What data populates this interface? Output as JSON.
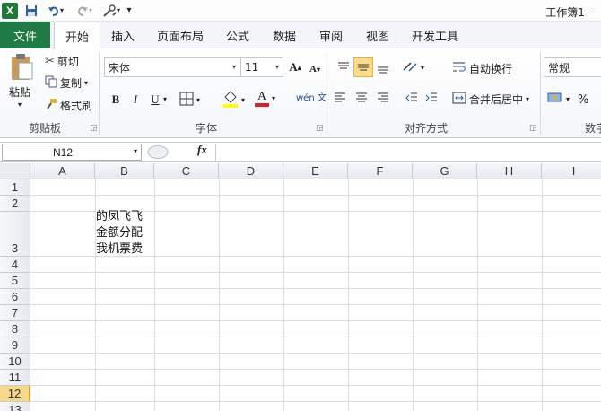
{
  "title_bar": {
    "app_icon": "X",
    "document_title": "工作簿1 -",
    "qa_icons": [
      "excel-icon",
      "save-icon",
      "undo-icon",
      "redo-icon",
      "tools-icon",
      "customize-icon"
    ]
  },
  "tabs": {
    "file": "文件",
    "items": [
      "开始",
      "插入",
      "页面布局",
      "公式",
      "数据",
      "审阅",
      "视图",
      "开发工具"
    ],
    "active": "开始"
  },
  "ribbon": {
    "clipboard": {
      "paste": "粘贴",
      "cut": "剪切",
      "copy": "复制",
      "format_painter": "格式刷",
      "label": "剪贴板"
    },
    "font": {
      "font_name": "宋体",
      "font_size": "11",
      "bold": "B",
      "italic": "I",
      "underline": "U",
      "grow": "A",
      "shrink": "A",
      "color_a": "A",
      "pinyin": "wén 文",
      "label": "字体"
    },
    "alignment": {
      "wrap_text": "自动换行",
      "merge_center": "合并后居中",
      "label": "对齐方式"
    },
    "number": {
      "format": "常规",
      "percent": "%",
      "label": "数字"
    }
  },
  "formula_bar": {
    "name_box": "N12",
    "fx": "fx",
    "value": ""
  },
  "sheet": {
    "columns": [
      "A",
      "B",
      "C",
      "D",
      "E",
      "F",
      "G",
      "H",
      "I"
    ],
    "rows": [
      "1",
      "2",
      "3",
      "4",
      "5",
      "6",
      "7",
      "8",
      "9",
      "10",
      "11",
      "12",
      "13"
    ],
    "active_row": "12",
    "cell_b3_lines": [
      "的凤飞飞",
      "金额分配",
      "我机票费"
    ]
  },
  "colors": {
    "file_tab": "#1f7b45",
    "active_row_header": "#f5d88a",
    "highlight_fill": "#ffff00",
    "font_color": "#e02020"
  }
}
